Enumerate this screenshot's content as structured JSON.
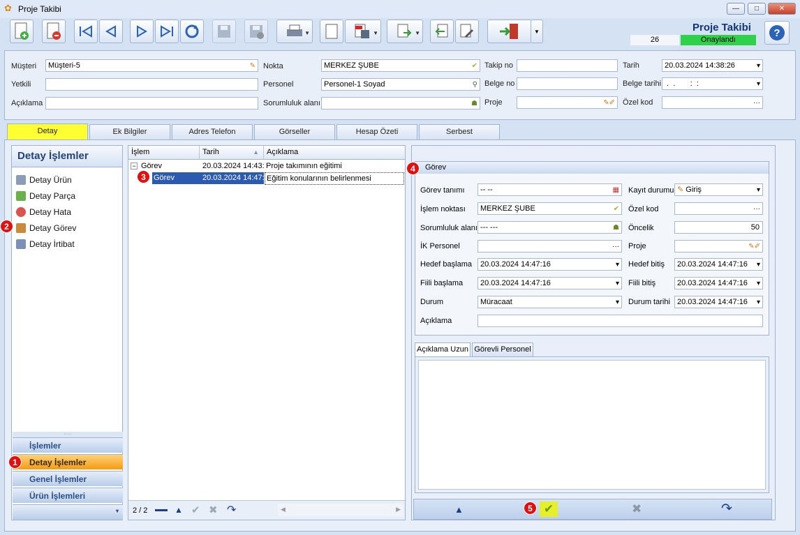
{
  "window": {
    "title": "Proje Takibi"
  },
  "header": {
    "title": "Proje Takibi",
    "record_number": "26",
    "status": "Onaylandı"
  },
  "form": {
    "musteri_label": "Müşteri",
    "musteri_value": "Müşteri-5",
    "yetkili_label": "Yetkili",
    "yetkili_value": "",
    "aciklama_label": "Açıklama",
    "aciklama_value": "",
    "nokta_label": "Nokta",
    "nokta_value": "MERKEZ ŞUBE",
    "personel_label": "Personel",
    "personel_value": "Personel-1 Soyad",
    "sorumluluk_label": "Sorumluluk alanı",
    "sorumluluk_value": "",
    "takip_label": "Takip no",
    "takip_value": "",
    "belge_label": "Belge no",
    "belge_value": "",
    "proje_label": "Proje",
    "proje_value": "",
    "tarih_label": "Tarih",
    "tarih_value": "20.03.2024 14:38:26",
    "belge_tarihi_label": "Belge tarihi",
    "belge_tarihi_value": " .  .       :  :",
    "ozel_kod_label": "Özel kod",
    "ozel_kod_value": ""
  },
  "tabs": [
    "Detay",
    "Ek Bilgiler",
    "Adres Telefon",
    "Görseller",
    "Hesap Özeti",
    "Serbest"
  ],
  "sidebar": {
    "title": "Detay İşlemler",
    "items": [
      "Detay Ürün",
      "Detay Parça",
      "Detay Hata",
      "Detay Görev",
      "Detay İrtibat"
    ],
    "nav": [
      "İşlemler",
      "Detay İşlemler",
      "Genel İşlemler",
      "Ürün İşlemleri"
    ]
  },
  "grid": {
    "columns": [
      "İşlem",
      "Tarih",
      "Açıklama"
    ],
    "rows": [
      {
        "islem": "Görev",
        "tarih": "20.03.2024 14:43:",
        "aciklama": "Proje takımının eğitimi"
      },
      {
        "islem": "Görev",
        "tarih": "20.03.2024 14:47:",
        "aciklama": "Eğitim konularının belirlenmesi"
      }
    ],
    "pager": "2 / 2"
  },
  "detail": {
    "group_title": "Görev",
    "gorev_tanimi_label": "Görev tanımı",
    "gorev_tanimi_value": "-- --",
    "islem_noktasi_label": "İşlem noktası",
    "islem_noktasi_value": "MERKEZ ŞUBE",
    "sorumluluk_label": "Sorumluluk alanı",
    "sorumluluk_value": "--- ---",
    "ik_personel_label": "İK Personel",
    "ik_personel_value": "",
    "hedef_baslama_label": "Hedef başlama",
    "hedef_baslama_value": "20.03.2024 14:47:16",
    "fiili_baslama_label": "Fiili başlama",
    "fiili_baslama_value": "20.03.2024 14:47:16",
    "durum_label": "Durum",
    "durum_value": "Müracaat",
    "aciklama_label": "Açıklama",
    "aciklama_value": "",
    "kayit_durumu_label": "Kayıt durumu",
    "kayit_durumu_value": "Giriş",
    "ozel_kod_label": "Özel kod",
    "ozel_kod_value": "",
    "oncelik_label": "Öncelik",
    "oncelik_value": "50",
    "proje_label": "Proje",
    "proje_value": "",
    "hedef_bitis_label": "Hedef bitiş",
    "hedef_bitis_value": "20.03.2024 14:47:16",
    "fiili_bitis_label": "Fiili bitiş",
    "fiili_bitis_value": "20.03.2024 14:47:16",
    "durum_tarihi_label": "Durum tarihi",
    "durum_tarihi_value": "20.03.2024 14:47:16",
    "subtabs": [
      "Açıklama Uzun",
      "Görevli Personel"
    ]
  },
  "badges": [
    "1",
    "2",
    "3",
    "4",
    "5"
  ]
}
